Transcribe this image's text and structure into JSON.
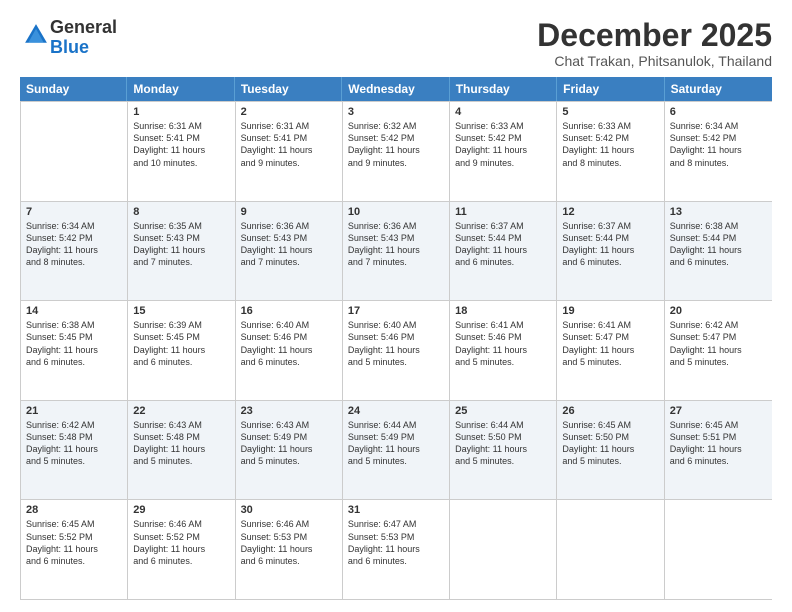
{
  "logo": {
    "general": "General",
    "blue": "Blue"
  },
  "title": "December 2025",
  "location": "Chat Trakan, Phitsanulok, Thailand",
  "days_of_week": [
    "Sunday",
    "Monday",
    "Tuesday",
    "Wednesday",
    "Thursday",
    "Friday",
    "Saturday"
  ],
  "weeks": [
    [
      {
        "day": "",
        "sunrise": "",
        "sunset": "",
        "daylight": "",
        "empty": true
      },
      {
        "day": "1",
        "sunrise": "Sunrise: 6:31 AM",
        "sunset": "Sunset: 5:41 PM",
        "daylight": "Daylight: 11 hours and 10 minutes."
      },
      {
        "day": "2",
        "sunrise": "Sunrise: 6:31 AM",
        "sunset": "Sunset: 5:41 PM",
        "daylight": "Daylight: 11 hours and 9 minutes."
      },
      {
        "day": "3",
        "sunrise": "Sunrise: 6:32 AM",
        "sunset": "Sunset: 5:42 PM",
        "daylight": "Daylight: 11 hours and 9 minutes."
      },
      {
        "day": "4",
        "sunrise": "Sunrise: 6:33 AM",
        "sunset": "Sunset: 5:42 PM",
        "daylight": "Daylight: 11 hours and 9 minutes."
      },
      {
        "day": "5",
        "sunrise": "Sunrise: 6:33 AM",
        "sunset": "Sunset: 5:42 PM",
        "daylight": "Daylight: 11 hours and 8 minutes."
      },
      {
        "day": "6",
        "sunrise": "Sunrise: 6:34 AM",
        "sunset": "Sunset: 5:42 PM",
        "daylight": "Daylight: 11 hours and 8 minutes."
      }
    ],
    [
      {
        "day": "7",
        "sunrise": "Sunrise: 6:34 AM",
        "sunset": "Sunset: 5:42 PM",
        "daylight": "Daylight: 11 hours and 8 minutes."
      },
      {
        "day": "8",
        "sunrise": "Sunrise: 6:35 AM",
        "sunset": "Sunset: 5:43 PM",
        "daylight": "Daylight: 11 hours and 7 minutes."
      },
      {
        "day": "9",
        "sunrise": "Sunrise: 6:36 AM",
        "sunset": "Sunset: 5:43 PM",
        "daylight": "Daylight: 11 hours and 7 minutes."
      },
      {
        "day": "10",
        "sunrise": "Sunrise: 6:36 AM",
        "sunset": "Sunset: 5:43 PM",
        "daylight": "Daylight: 11 hours and 7 minutes."
      },
      {
        "day": "11",
        "sunrise": "Sunrise: 6:37 AM",
        "sunset": "Sunset: 5:44 PM",
        "daylight": "Daylight: 11 hours and 6 minutes."
      },
      {
        "day": "12",
        "sunrise": "Sunrise: 6:37 AM",
        "sunset": "Sunset: 5:44 PM",
        "daylight": "Daylight: 11 hours and 6 minutes."
      },
      {
        "day": "13",
        "sunrise": "Sunrise: 6:38 AM",
        "sunset": "Sunset: 5:44 PM",
        "daylight": "Daylight: 11 hours and 6 minutes."
      }
    ],
    [
      {
        "day": "14",
        "sunrise": "Sunrise: 6:38 AM",
        "sunset": "Sunset: 5:45 PM",
        "daylight": "Daylight: 11 hours and 6 minutes."
      },
      {
        "day": "15",
        "sunrise": "Sunrise: 6:39 AM",
        "sunset": "Sunset: 5:45 PM",
        "daylight": "Daylight: 11 hours and 6 minutes."
      },
      {
        "day": "16",
        "sunrise": "Sunrise: 6:40 AM",
        "sunset": "Sunset: 5:46 PM",
        "daylight": "Daylight: 11 hours and 6 minutes."
      },
      {
        "day": "17",
        "sunrise": "Sunrise: 6:40 AM",
        "sunset": "Sunset: 5:46 PM",
        "daylight": "Daylight: 11 hours and 5 minutes."
      },
      {
        "day": "18",
        "sunrise": "Sunrise: 6:41 AM",
        "sunset": "Sunset: 5:46 PM",
        "daylight": "Daylight: 11 hours and 5 minutes."
      },
      {
        "day": "19",
        "sunrise": "Sunrise: 6:41 AM",
        "sunset": "Sunset: 5:47 PM",
        "daylight": "Daylight: 11 hours and 5 minutes."
      },
      {
        "day": "20",
        "sunrise": "Sunrise: 6:42 AM",
        "sunset": "Sunset: 5:47 PM",
        "daylight": "Daylight: 11 hours and 5 minutes."
      }
    ],
    [
      {
        "day": "21",
        "sunrise": "Sunrise: 6:42 AM",
        "sunset": "Sunset: 5:48 PM",
        "daylight": "Daylight: 11 hours and 5 minutes."
      },
      {
        "day": "22",
        "sunrise": "Sunrise: 6:43 AM",
        "sunset": "Sunset: 5:48 PM",
        "daylight": "Daylight: 11 hours and 5 minutes."
      },
      {
        "day": "23",
        "sunrise": "Sunrise: 6:43 AM",
        "sunset": "Sunset: 5:49 PM",
        "daylight": "Daylight: 11 hours and 5 minutes."
      },
      {
        "day": "24",
        "sunrise": "Sunrise: 6:44 AM",
        "sunset": "Sunset: 5:49 PM",
        "daylight": "Daylight: 11 hours and 5 minutes."
      },
      {
        "day": "25",
        "sunrise": "Sunrise: 6:44 AM",
        "sunset": "Sunset: 5:50 PM",
        "daylight": "Daylight: 11 hours and 5 minutes."
      },
      {
        "day": "26",
        "sunrise": "Sunrise: 6:45 AM",
        "sunset": "Sunset: 5:50 PM",
        "daylight": "Daylight: 11 hours and 5 minutes."
      },
      {
        "day": "27",
        "sunrise": "Sunrise: 6:45 AM",
        "sunset": "Sunset: 5:51 PM",
        "daylight": "Daylight: 11 hours and 6 minutes."
      }
    ],
    [
      {
        "day": "28",
        "sunrise": "Sunrise: 6:45 AM",
        "sunset": "Sunset: 5:52 PM",
        "daylight": "Daylight: 11 hours and 6 minutes."
      },
      {
        "day": "29",
        "sunrise": "Sunrise: 6:46 AM",
        "sunset": "Sunset: 5:52 PM",
        "daylight": "Daylight: 11 hours and 6 minutes."
      },
      {
        "day": "30",
        "sunrise": "Sunrise: 6:46 AM",
        "sunset": "Sunset: 5:53 PM",
        "daylight": "Daylight: 11 hours and 6 minutes."
      },
      {
        "day": "31",
        "sunrise": "Sunrise: 6:47 AM",
        "sunset": "Sunset: 5:53 PM",
        "daylight": "Daylight: 11 hours and 6 minutes."
      },
      {
        "day": "",
        "sunrise": "",
        "sunset": "",
        "daylight": "",
        "empty": true
      },
      {
        "day": "",
        "sunrise": "",
        "sunset": "",
        "daylight": "",
        "empty": true
      },
      {
        "day": "",
        "sunrise": "",
        "sunset": "",
        "daylight": "",
        "empty": true
      }
    ]
  ]
}
